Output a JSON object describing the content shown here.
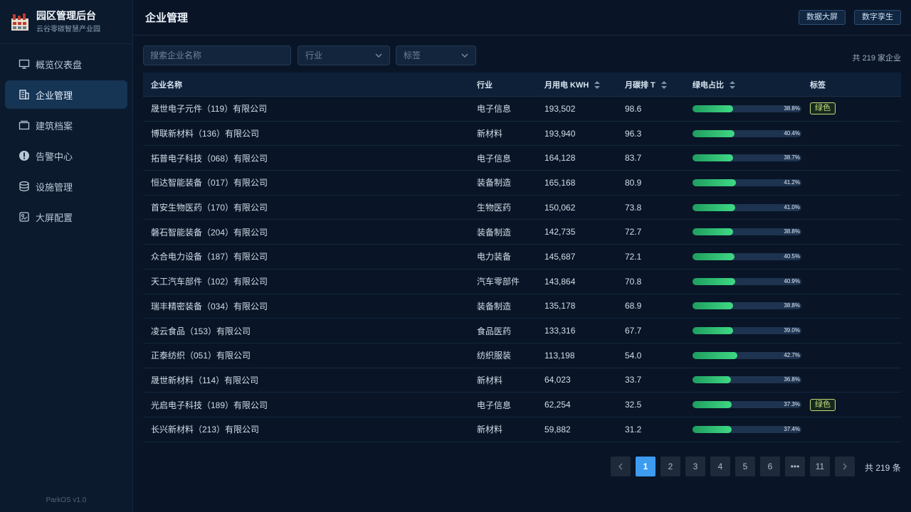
{
  "brand": {
    "title": "园区管理后台",
    "subtitle": "云谷零碳智慧产业园"
  },
  "sidebar": {
    "items": [
      {
        "label": "概览仪表盘",
        "icon": "monitor-icon"
      },
      {
        "label": "企业管理",
        "icon": "building-icon",
        "active": true
      },
      {
        "label": "建筑档案",
        "icon": "folder-icon"
      },
      {
        "label": "告警中心",
        "icon": "alert-icon"
      },
      {
        "label": "设施管理",
        "icon": "database-icon"
      },
      {
        "label": "大屏配置",
        "icon": "screen-config-icon"
      }
    ],
    "version": "ParkOS v1.0"
  },
  "header": {
    "title": "企业管理",
    "btn_screen": "数据大屏",
    "btn_twin": "数字孪生"
  },
  "filters": {
    "search_placeholder": "搜索企业名称",
    "industry_placeholder": "行业",
    "tag_placeholder": "标签",
    "total": "共 219 家企业"
  },
  "table": {
    "columns": {
      "name": "企业名称",
      "industry": "行业",
      "kwh": "月用电 KWH",
      "co2": "月碳排 T",
      "green": "绿电占比",
      "tag": "标签"
    },
    "rows": [
      {
        "name": "晟世电子元件（119）有限公司",
        "industry": "电子信息",
        "kwh": "193,502",
        "co2": "98.6",
        "green": 38.8,
        "green_text": "38.8%",
        "tag": "绿色"
      },
      {
        "name": "博联新材料（136）有限公司",
        "industry": "新材料",
        "kwh": "193,940",
        "co2": "96.3",
        "green": 40.4,
        "green_text": "40.4%",
        "tag": ""
      },
      {
        "name": "拓普电子科技（068）有限公司",
        "industry": "电子信息",
        "kwh": "164,128",
        "co2": "83.7",
        "green": 38.7,
        "green_text": "38.7%",
        "tag": ""
      },
      {
        "name": "恒达智能装备（017）有限公司",
        "industry": "装备制造",
        "kwh": "165,168",
        "co2": "80.9",
        "green": 41.2,
        "green_text": "41.2%",
        "tag": ""
      },
      {
        "name": "首安生物医药（170）有限公司",
        "industry": "生物医药",
        "kwh": "150,062",
        "co2": "73.8",
        "green": 41.0,
        "green_text": "41.0%",
        "tag": ""
      },
      {
        "name": "磐石智能装备（204）有限公司",
        "industry": "装备制造",
        "kwh": "142,735",
        "co2": "72.7",
        "green": 38.8,
        "green_text": "38.8%",
        "tag": ""
      },
      {
        "name": "众合电力设备（187）有限公司",
        "industry": "电力装备",
        "kwh": "145,687",
        "co2": "72.1",
        "green": 40.5,
        "green_text": "40.5%",
        "tag": ""
      },
      {
        "name": "天工汽车部件（102）有限公司",
        "industry": "汽车零部件",
        "kwh": "143,864",
        "co2": "70.8",
        "green": 40.9,
        "green_text": "40.9%",
        "tag": ""
      },
      {
        "name": "瑞丰精密装备（034）有限公司",
        "industry": "装备制造",
        "kwh": "135,178",
        "co2": "68.9",
        "green": 38.8,
        "green_text": "38.8%",
        "tag": ""
      },
      {
        "name": "凌云食品（153）有限公司",
        "industry": "食品医药",
        "kwh": "133,316",
        "co2": "67.7",
        "green": 39.0,
        "green_text": "39.0%",
        "tag": ""
      },
      {
        "name": "正泰纺织（051）有限公司",
        "industry": "纺织服装",
        "kwh": "113,198",
        "co2": "54.0",
        "green": 42.7,
        "green_text": "42.7%",
        "tag": ""
      },
      {
        "name": "晟世新材料（114）有限公司",
        "industry": "新材料",
        "kwh": "64,023",
        "co2": "33.7",
        "green": 36.8,
        "green_text": "36.8%",
        "tag": ""
      },
      {
        "name": "光启电子科技（189）有限公司",
        "industry": "电子信息",
        "kwh": "62,254",
        "co2": "32.5",
        "green": 37.3,
        "green_text": "37.3%",
        "tag": "绿色"
      },
      {
        "name": "长兴新材料（213）有限公司",
        "industry": "新材料",
        "kwh": "59,882",
        "co2": "31.2",
        "green": 37.4,
        "green_text": "37.4%",
        "tag": ""
      }
    ]
  },
  "pagination": {
    "pages": [
      "1",
      "2",
      "3",
      "4",
      "5",
      "6",
      "•••",
      "11"
    ],
    "current": "1",
    "total": "共 219 条"
  }
}
